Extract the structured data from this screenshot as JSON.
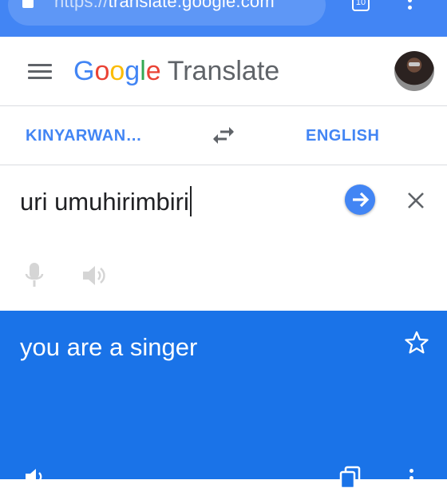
{
  "browser": {
    "url_scheme": "https://",
    "url_host": "translate.google.com",
    "tab_count": "10"
  },
  "header": {
    "brand": [
      "G",
      "o",
      "o",
      "g",
      "l",
      "e"
    ],
    "product": "Translate"
  },
  "languages": {
    "source": "KINYARWAND…",
    "target": "ENGLISH"
  },
  "input": {
    "text": "uri umuhirimbiri"
  },
  "result": {
    "text": "you are a singer"
  },
  "colors": {
    "browser_bar": "#4285f4",
    "accent": "#4285f4",
    "result_bg": "#1a73e8",
    "icon_gray": "#5f6368"
  }
}
